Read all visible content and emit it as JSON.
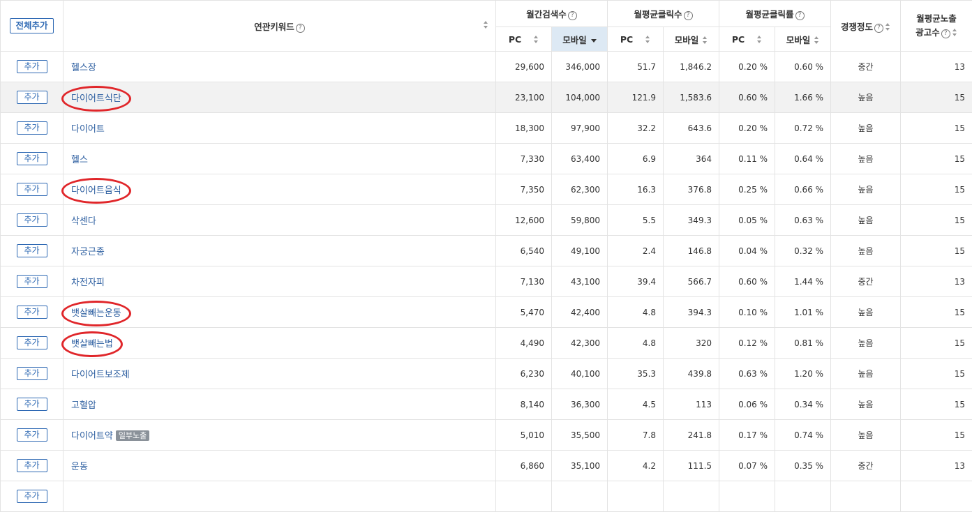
{
  "header": {
    "add_all_label": "전체추가",
    "keyword_label": "연관키워드",
    "monthly_search_label": "월간검색수",
    "avg_clicks_label": "월평균클릭수",
    "avg_ctr_label": "월평균클릭률",
    "competition_label": "경쟁정도",
    "ad_count_label_1": "월평균노출",
    "ad_count_label_2": "광고수",
    "pc_label": "PC",
    "mobile_label": "모바일",
    "help_glyph": "?"
  },
  "add_label": "추가",
  "rows": [
    {
      "keyword": "헬스장",
      "badge": "",
      "pc_search": "29,600",
      "mobile_search": "346,000",
      "pc_clicks": "51.7",
      "mobile_clicks": "1,846.2",
      "pc_ctr": "0.20 %",
      "mobile_ctr": "0.60 %",
      "competition": "중간",
      "ads": "13"
    },
    {
      "keyword": "다이어트식단",
      "badge": "",
      "pc_search": "23,100",
      "mobile_search": "104,000",
      "pc_clicks": "121.9",
      "mobile_clicks": "1,583.6",
      "pc_ctr": "0.60 %",
      "mobile_ctr": "1.66 %",
      "competition": "높음",
      "ads": "15"
    },
    {
      "keyword": "다이어트",
      "badge": "",
      "pc_search": "18,300",
      "mobile_search": "97,900",
      "pc_clicks": "32.2",
      "mobile_clicks": "643.6",
      "pc_ctr": "0.20 %",
      "mobile_ctr": "0.72 %",
      "competition": "높음",
      "ads": "15"
    },
    {
      "keyword": "헬스",
      "badge": "",
      "pc_search": "7,330",
      "mobile_search": "63,400",
      "pc_clicks": "6.9",
      "mobile_clicks": "364",
      "pc_ctr": "0.11 %",
      "mobile_ctr": "0.64 %",
      "competition": "높음",
      "ads": "15"
    },
    {
      "keyword": "다이어트음식",
      "badge": "",
      "pc_search": "7,350",
      "mobile_search": "62,300",
      "pc_clicks": "16.3",
      "mobile_clicks": "376.8",
      "pc_ctr": "0.25 %",
      "mobile_ctr": "0.66 %",
      "competition": "높음",
      "ads": "15"
    },
    {
      "keyword": "삭센다",
      "badge": "",
      "pc_search": "12,600",
      "mobile_search": "59,800",
      "pc_clicks": "5.5",
      "mobile_clicks": "349.3",
      "pc_ctr": "0.05 %",
      "mobile_ctr": "0.63 %",
      "competition": "높음",
      "ads": "15"
    },
    {
      "keyword": "자궁근종",
      "badge": "",
      "pc_search": "6,540",
      "mobile_search": "49,100",
      "pc_clicks": "2.4",
      "mobile_clicks": "146.8",
      "pc_ctr": "0.04 %",
      "mobile_ctr": "0.32 %",
      "competition": "높음",
      "ads": "15"
    },
    {
      "keyword": "차전자피",
      "badge": "",
      "pc_search": "7,130",
      "mobile_search": "43,100",
      "pc_clicks": "39.4",
      "mobile_clicks": "566.7",
      "pc_ctr": "0.60 %",
      "mobile_ctr": "1.44 %",
      "competition": "중간",
      "ads": "13"
    },
    {
      "keyword": "뱃살빼는운동",
      "badge": "",
      "pc_search": "5,470",
      "mobile_search": "42,400",
      "pc_clicks": "4.8",
      "mobile_clicks": "394.3",
      "pc_ctr": "0.10 %",
      "mobile_ctr": "1.01 %",
      "competition": "높음",
      "ads": "15"
    },
    {
      "keyword": "뱃살빼는법",
      "badge": "",
      "pc_search": "4,490",
      "mobile_search": "42,300",
      "pc_clicks": "4.8",
      "mobile_clicks": "320",
      "pc_ctr": "0.12 %",
      "mobile_ctr": "0.81 %",
      "competition": "높음",
      "ads": "15"
    },
    {
      "keyword": "다이어트보조제",
      "badge": "",
      "pc_search": "6,230",
      "mobile_search": "40,100",
      "pc_clicks": "35.3",
      "mobile_clicks": "439.8",
      "pc_ctr": "0.63 %",
      "mobile_ctr": "1.20 %",
      "competition": "높음",
      "ads": "15"
    },
    {
      "keyword": "고혈압",
      "badge": "",
      "pc_search": "8,140",
      "mobile_search": "36,300",
      "pc_clicks": "4.5",
      "mobile_clicks": "113",
      "pc_ctr": "0.06 %",
      "mobile_ctr": "0.34 %",
      "competition": "높음",
      "ads": "15"
    },
    {
      "keyword": "다이어트약",
      "badge": "일부노출",
      "pc_search": "5,010",
      "mobile_search": "35,500",
      "pc_clicks": "7.8",
      "mobile_clicks": "241.8",
      "pc_ctr": "0.17 %",
      "mobile_ctr": "0.74 %",
      "competition": "높음",
      "ads": "15"
    },
    {
      "keyword": "운동",
      "badge": "",
      "pc_search": "6,860",
      "mobile_search": "35,100",
      "pc_clicks": "4.2",
      "mobile_clicks": "111.5",
      "pc_ctr": "0.07 %",
      "mobile_ctr": "0.35 %",
      "competition": "중간",
      "ads": "13"
    }
  ],
  "colors": {
    "link": "#2a5c9f",
    "button_border": "#2d68b3",
    "active_sort_column": "#dde9f4",
    "highlight_row": "#f2f2f2",
    "annotation_red": "#e0262a",
    "badge_gray": "#8a9199"
  },
  "annotations": {
    "circled_rows": [
      1,
      4,
      8,
      9
    ]
  }
}
